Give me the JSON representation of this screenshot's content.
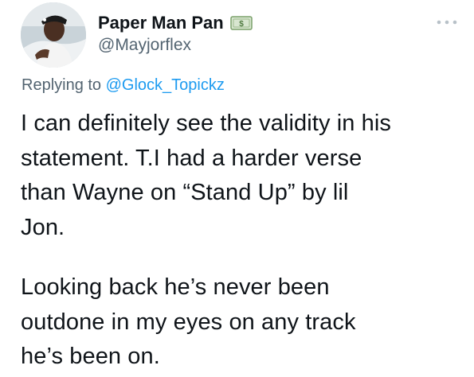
{
  "tweet": {
    "author": {
      "display_name": "Paper Man Pan",
      "handle": "@Mayjorflex",
      "badge_icon": "money-emoji-icon"
    },
    "more_icon": "more-options-icon",
    "reply_context": {
      "prefix": "Replying to ",
      "mention": "@Glock_Topickz"
    },
    "paragraphs": [
      {
        "lines": [
          "I can definitely see the validity in his",
          "statement. T.I had a harder verse",
          "than Wayne on “Stand Up” by lil",
          "Jon."
        ]
      },
      {
        "lines": [
          "Looking back he’s never been",
          "outdone in my eyes on any track",
          "he’s been on."
        ]
      }
    ],
    "colors": {
      "text_primary": "#0f1419",
      "text_secondary": "#536471",
      "link": "#1d9bf0"
    }
  }
}
